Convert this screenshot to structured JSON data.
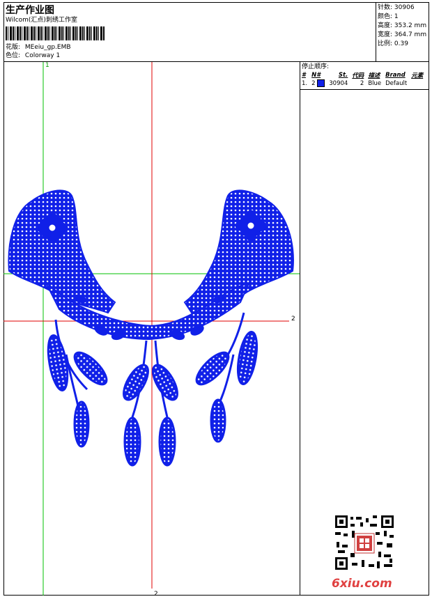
{
  "header": {
    "title": "生产作业图",
    "company": "Wilcom(汇点)刺绣工作室",
    "design_label": "花版:",
    "design_file": "MEeiu_gp.EMB",
    "colorway_label": "色位:",
    "colorway": "Colorway 1"
  },
  "stats": [
    {
      "label": "针数",
      "value": "30906"
    },
    {
      "label": "颜色",
      "value": "1"
    },
    {
      "label": "高度",
      "value": "353.2 mm"
    },
    {
      "label": "宽度",
      "value": "364.7 mm"
    },
    {
      "label": "比例",
      "value": "0.39"
    }
  ],
  "stops": {
    "heading": "停止顺序:",
    "columns": [
      "#",
      "N#",
      "St.",
      "代码",
      "描述",
      "Brand",
      "元素"
    ],
    "rows": [
      {
        "num": "1.",
        "needle": "2",
        "stitches": "30904",
        "code": "2",
        "desc": "Blue",
        "brand": "Default",
        "color": "#1020e8"
      }
    ]
  },
  "guides": {
    "green_v_label": "1",
    "red_h_label": "2",
    "red_v_label": "2"
  },
  "watermark": {
    "text": "6xiu.com",
    "qr": "qr-code-icon"
  },
  "colors": {
    "thread": "#1020e8",
    "guide_red": "#e00000",
    "guide_green": "#00c000"
  }
}
